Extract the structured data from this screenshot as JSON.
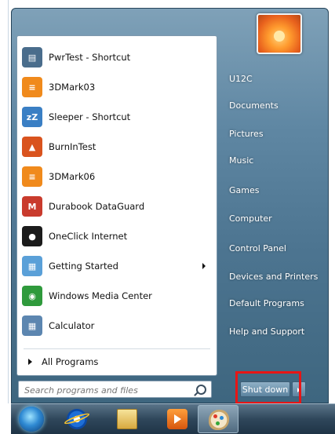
{
  "start_menu": {
    "programs": [
      {
        "label": "PwrTest - Shortcut",
        "icon": "pwrtest-icon",
        "color": "#4a6d8c",
        "glyph": "▤"
      },
      {
        "label": "3DMark03",
        "icon": "3dmark03-icon",
        "color": "#f08a1c",
        "glyph": "≡"
      },
      {
        "label": "Sleeper - Shortcut",
        "icon": "sleeper-icon",
        "color": "#3a7fc4",
        "glyph": "zZ"
      },
      {
        "label": "BurnInTest",
        "icon": "burnintest-icon",
        "color": "#d9531e",
        "glyph": "▲"
      },
      {
        "label": "3DMark06",
        "icon": "3dmark06-icon",
        "color": "#f08a1c",
        "glyph": "≡"
      },
      {
        "label": "Durabook DataGuard",
        "icon": "dataguard-icon",
        "color": "#c93b2d",
        "glyph": "M"
      },
      {
        "label": "OneClick Internet",
        "icon": "oneclick-icon",
        "color": "#1b1b1b",
        "glyph": "●"
      },
      {
        "label": "Getting Started",
        "icon": "getting-started-icon",
        "color": "#5aa0d8",
        "glyph": "▦"
      },
      {
        "label": "Windows Media Center",
        "icon": "media-center-icon",
        "color": "#2f9a3c",
        "glyph": "◉"
      },
      {
        "label": "Calculator",
        "icon": "calculator-icon",
        "color": "#5c86b0",
        "glyph": "▦"
      }
    ],
    "all_programs_label": "All Programs",
    "search_placeholder": "Search programs and files",
    "right_items": [
      {
        "label": "U12C"
      },
      {
        "label": "Documents"
      },
      {
        "label": "Pictures"
      },
      {
        "label": "Music"
      },
      {
        "label": "Games"
      },
      {
        "label": "Computer"
      },
      {
        "label": "Control Panel"
      },
      {
        "label": "Devices and Printers"
      },
      {
        "label": "Default Programs"
      },
      {
        "label": "Help and Support"
      }
    ],
    "shutdown_label": "Shut down",
    "highlight_color": "#e81515"
  },
  "taskbar": {
    "items": [
      "start-orb-icon",
      "internet-explorer-icon",
      "windows-explorer-icon",
      "media-player-icon",
      "paint-icon"
    ]
  }
}
